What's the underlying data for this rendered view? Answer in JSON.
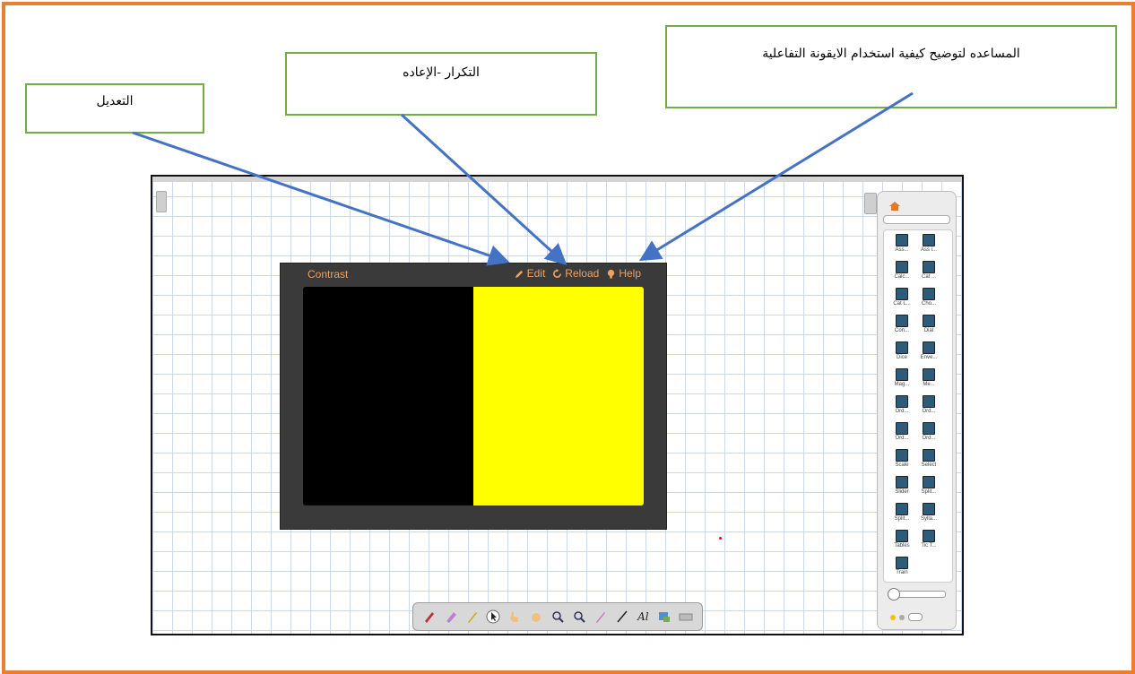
{
  "callouts": {
    "edit": "التعديل",
    "reload": "التكرار -الإعاده",
    "help": "المساعده لتوضيح كيفية استخدام الايقونة التفاعلية"
  },
  "widget": {
    "title": "Contrast",
    "edit_label": "Edit",
    "reload_label": "Reload",
    "help_label": "Help",
    "left_color": "#000000",
    "right_color": "#ffff00"
  },
  "gallery": {
    "items": [
      "Ass...",
      "Ass i...",
      "Calc...",
      "Cat ...",
      "Cat L...",
      "Cho...",
      "Con...",
      "Dial",
      "Dice",
      "Enve...",
      "Mag...",
      "Me...",
      "Ord...",
      "Ord...",
      "Ord...",
      "Ord...",
      "Scale",
      "Select",
      "Slider",
      "Split...",
      "Split...",
      "Sylla...",
      "Tables",
      "Tic T...",
      "Train"
    ]
  },
  "toolbar": {
    "tools": [
      "pen-icon",
      "highlighter-icon",
      "creative-pen-icon",
      "select-icon",
      "hand-pointer-icon",
      "pan-icon",
      "zoom-in-icon",
      "zoom-out-icon",
      "magic-pen-icon",
      "line-icon",
      "text-icon",
      "shape-icon",
      "table-icon"
    ],
    "text_tool_label": "Al"
  },
  "colors": {
    "frame": "#ed7d31",
    "callout_border": "#70ad47",
    "arrow": "#4472c4",
    "widget_accent": "#f0a060"
  }
}
